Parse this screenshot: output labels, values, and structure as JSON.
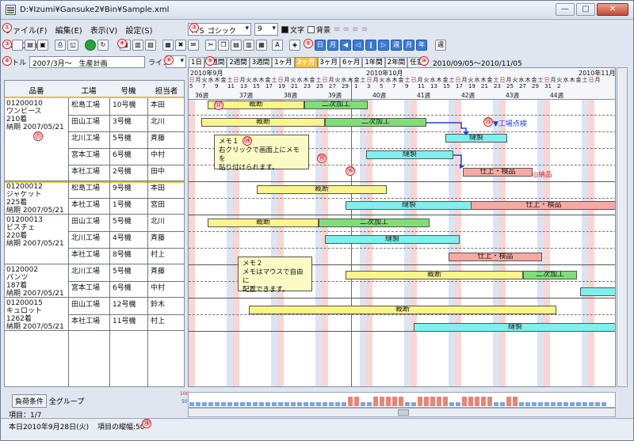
{
  "window": {
    "title": "D:¥Izumi¥Gansuke2¥Bin¥Sample.xml",
    "btn_min": "—",
    "btn_max": "□",
    "btn_close": "✕"
  },
  "menu": [
    "ファイル(F)",
    "編集(E)",
    "表示(V)",
    "設定(S)",
    "ヘルプ(H)"
  ],
  "font": {
    "name": "ＭＳ ゴシック",
    "size": "9",
    "text_label": "文字",
    "bg_label": "背景"
  },
  "toolbar_right_labels": [
    "週",
    "月",
    "年"
  ],
  "title_field": {
    "label": "トル",
    "value": "2007/3月～　生産計画"
  },
  "line": {
    "label": "ライン",
    "value": "5"
  },
  "scales": [
    "1日",
    "1週間",
    "2週間",
    "3週間",
    "1ヶ月",
    "2ヶ月",
    "3ヶ月",
    "6ヶ月",
    "1年間",
    "2年間",
    "任意"
  ],
  "scale_active": "2ヶ月",
  "date_range": "2010/09/05～2010/11/05",
  "badges": [
    "①",
    "②",
    "③",
    "④",
    "⑤",
    "⑥",
    "⑦",
    "⑧",
    "⑨",
    "⑩",
    "⑪",
    "⑫",
    "⑬",
    "⑭",
    "⑮",
    "⑯",
    "⑰",
    "⑱"
  ],
  "columns": {
    "item": "品番",
    "factory": "工場",
    "line": "号機",
    "person": "担当者"
  },
  "items": [
    {
      "code": "01200010",
      "name": "ワンピース",
      "qty": "210着",
      "due": "納期 2007/05/21",
      "rows": [
        [
          "松島工場",
          "10号機",
          "本田"
        ],
        [
          "田山工場",
          "3号機",
          "北川"
        ],
        [
          "北川工場",
          "5号機",
          "斉藤"
        ],
        [
          "宮本工場",
          "6号機",
          "中村"
        ],
        [
          "本社工場",
          "2号機",
          "田中"
        ]
      ]
    },
    {
      "code": "01200012",
      "name": "ジャケット",
      "qty": "225着",
      "due": "納期 2007/05/21",
      "rows": [
        [
          "松島工場",
          "9号機",
          "本田"
        ],
        [
          "本社工場",
          "1号機",
          "宮田"
        ]
      ]
    },
    {
      "code": "01200013",
      "name": "ビスチェ",
      "qty": "220着",
      "due": "納期 2007/05/21",
      "rows": [
        [
          "田山工場",
          "5号機",
          "北川"
        ],
        [
          "北川工場",
          "4号機",
          "斉藤"
        ],
        [
          "本社工場",
          "8号機",
          "村上"
        ]
      ]
    },
    {
      "code": "0120002",
      "name": "パンツ",
      "qty": "187着",
      "due": "納期 2007/05/21",
      "rows": [
        [
          "北川工場",
          "5号機",
          "斉藤"
        ],
        [
          "宮本工場",
          "6号機",
          "中村"
        ]
      ]
    },
    {
      "code": "01200015",
      "name": "キュロット",
      "qty": "1262着",
      "due": "納期 2007/05/21",
      "rows": [
        [
          "田山工場",
          "12号機",
          "鈴木"
        ],
        [
          "本社工場",
          "11号機",
          "村上"
        ]
      ]
    }
  ],
  "gantt": {
    "months": [
      {
        "label": "2010年9月"
      },
      {
        "label": "2010年10月"
      },
      {
        "label": "2010年11月"
      }
    ],
    "weeks": [
      "36週",
      "37週",
      "38週",
      "39週",
      "40週",
      "41週",
      "42週",
      "43週",
      "44週"
    ],
    "days": [
      "5",
      "7",
      "9",
      "11",
      "13",
      "15",
      "17",
      "19",
      "21",
      "23",
      "25",
      "27",
      "29",
      "1",
      "3",
      "5",
      "7",
      "9",
      "11",
      "13",
      "15",
      "17",
      "19",
      "21",
      "23",
      "25",
      "27",
      "29",
      "31",
      "2"
    ],
    "weekdays": [
      "日",
      "月",
      "火",
      "水",
      "木",
      "金",
      "土",
      "日",
      "月",
      "火",
      "水",
      "木",
      "金",
      "土",
      "日",
      "月",
      "火",
      "水",
      "木",
      "金",
      "土",
      "日",
      "月",
      "火",
      "水",
      "木",
      "金",
      "土",
      "日",
      "月",
      "火",
      "水",
      "木",
      "金",
      "土",
      "日",
      "月",
      "火",
      "水",
      "木",
      "金",
      "土",
      "日",
      "月",
      "火",
      "水",
      "木",
      "金",
      "土",
      "日",
      "月",
      "火",
      "水",
      "木",
      "金",
      "土",
      "日",
      "月",
      "火",
      "水",
      "木",
      "金",
      "土",
      "日",
      "月"
    ],
    "bars": {
      "b1": "裁断",
      "b2": "二次加工",
      "b3": "裁断",
      "b4": "二次加工",
      "b5": "縫製",
      "b6": "縫製",
      "b7": "仕上・検品",
      "b8": "裁断",
      "b9": "縫製",
      "b10": "仕上・検品",
      "b11": "裁断",
      "b12": "二次加工",
      "b13": "縫製",
      "b14": "仕上・検品",
      "b15": "裁断",
      "b16": "二次加工",
      "b17": "裁断",
      "b18": "縫製"
    },
    "markers": {
      "inspection": "▼工場点検",
      "delivery": "◎納品"
    },
    "memo1": {
      "title": "メモ１",
      "body1": "右クリックで画面上にメモを",
      "body2": "貼り付けられます。"
    },
    "memo2": {
      "title": "メモ２",
      "body1": "メモはマウスで自由に",
      "body2": "配置できます。"
    }
  },
  "load_scale": {
    "top": "100",
    "bottom": "50"
  },
  "bottom": {
    "cond_button": "負荷条件",
    "group": "全グループ"
  },
  "status": {
    "item_count": "項目：1/7",
    "today": "本日2010年9月28日(火)",
    "height": "項目の縦幅:50"
  }
}
